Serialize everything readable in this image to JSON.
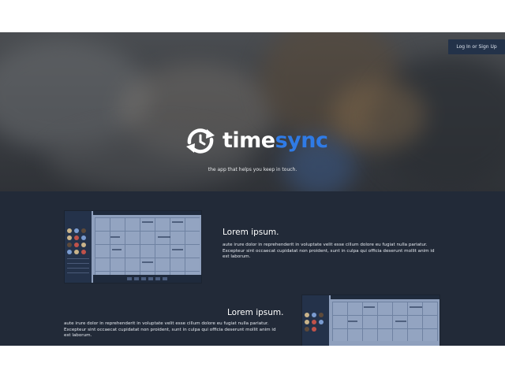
{
  "header": {
    "login_label": "Log In or Sign Up"
  },
  "hero": {
    "brand_part1": "time",
    "brand_part2": "sync",
    "tagline": "the app that helps you keep in touch."
  },
  "features": [
    {
      "title": "Lorem ipsum.",
      "body": "aute irure dolor in reprehenderit in voluptate velit esse cillum dolore eu fugiat nulla pariatur. Excepteur sint occaecat cupidatat non proident, sunt in culpa qui officia deserunt mollit anim id est laborum."
    },
    {
      "title": "Lorem ipsum.",
      "body": "aute irure dolor in reprehenderit in voluptate velit esse cillum dolore eu fugiat nulla pariatur. Excepteur sint occaecat cupidatat non proident, sunt in culpa qui officia deserunt mollit anim id est laborum."
    }
  ],
  "colors": {
    "brand_blue": "#2f7be6",
    "navy_section": "#222a38",
    "login_bg": "#233249"
  },
  "icons": {
    "logo": "sync-arrows-icon"
  }
}
